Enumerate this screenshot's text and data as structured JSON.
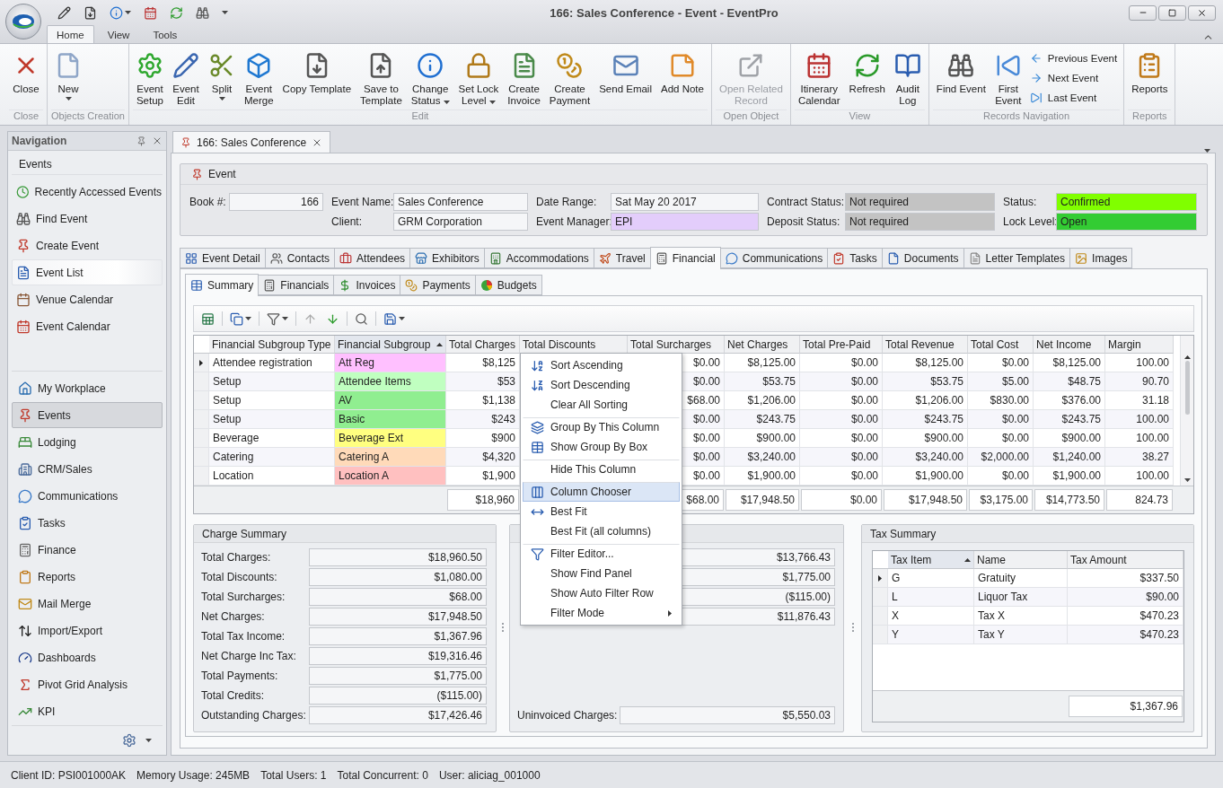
{
  "window": {
    "title": "166: Sales Conference - Event - EventPro"
  },
  "ribbon_tabs": [
    {
      "label": "Home",
      "selected": true
    },
    {
      "label": "View",
      "selected": false
    },
    {
      "label": "Tools",
      "selected": false
    }
  ],
  "ribbon_groups": [
    {
      "label": "Close",
      "buttons": [
        {
          "label": "Close",
          "dropdown": false,
          "disabled": false
        }
      ]
    },
    {
      "label": "Objects Creation",
      "buttons": [
        {
          "label": "New",
          "dropdown": true,
          "disabled": false
        }
      ]
    },
    {
      "label": "Edit",
      "buttons": [
        {
          "label": "Event\nSetup",
          "dropdown": false,
          "disabled": false
        },
        {
          "label": "Event\nEdit",
          "dropdown": false,
          "disabled": false
        },
        {
          "label": "Split",
          "dropdown": true,
          "disabled": false
        },
        {
          "label": "Event\nMerge",
          "dropdown": false,
          "disabled": false
        },
        {
          "label": "Copy Template",
          "dropdown": false,
          "disabled": false
        },
        {
          "label": "Save to\nTemplate",
          "dropdown": false,
          "disabled": false
        },
        {
          "label": "Change\nStatus",
          "dropdown": true,
          "disabled": false
        },
        {
          "label": "Set Lock\nLevel",
          "dropdown": true,
          "disabled": false
        },
        {
          "label": "Create\nInvoice",
          "dropdown": false,
          "disabled": false
        },
        {
          "label": "Create\nPayment",
          "dropdown": false,
          "disabled": false
        },
        {
          "label": "Send Email",
          "dropdown": false,
          "disabled": false
        },
        {
          "label": "Add Note",
          "dropdown": false,
          "disabled": false
        }
      ]
    },
    {
      "label": "Open Object",
      "buttons": [
        {
          "label": "Open Related\nRecord",
          "dropdown": false,
          "disabled": true
        }
      ]
    },
    {
      "label": "View",
      "buttons": [
        {
          "label": "Itinerary\nCalendar",
          "dropdown": false,
          "disabled": false
        },
        {
          "label": "Refresh",
          "dropdown": false,
          "disabled": false
        },
        {
          "label": "Audit\nLog",
          "dropdown": false,
          "disabled": false
        }
      ]
    },
    {
      "label": "Records Navigation",
      "buttons": [
        {
          "label": "Find Event",
          "dropdown": false,
          "disabled": false
        },
        {
          "label": "First\nEvent",
          "dropdown": false,
          "disabled": false
        }
      ],
      "small_buttons": [
        {
          "label": "Previous Event"
        },
        {
          "label": "Next Event"
        },
        {
          "label": "Last Event"
        }
      ]
    },
    {
      "label": "Reports",
      "buttons": [
        {
          "label": "Reports",
          "dropdown": false,
          "disabled": false
        }
      ]
    }
  ],
  "navigation": {
    "title": "Navigation",
    "section": "Events",
    "items": [
      {
        "label": "Recently Accessed Events",
        "selected": false
      },
      {
        "label": "Find Event",
        "selected": false
      },
      {
        "label": "Create Event",
        "selected": false
      },
      {
        "label": "Event List",
        "selected": true
      },
      {
        "label": "Venue Calendar",
        "selected": false
      },
      {
        "label": "Event Calendar",
        "selected": false
      }
    ],
    "modules": [
      {
        "label": "My Workplace",
        "selected": false
      },
      {
        "label": "Events",
        "selected": true
      },
      {
        "label": "Lodging",
        "selected": false
      },
      {
        "label": "CRM/Sales",
        "selected": false
      },
      {
        "label": "Communications",
        "selected": false
      },
      {
        "label": "Tasks",
        "selected": false
      },
      {
        "label": "Finance",
        "selected": false
      },
      {
        "label": "Reports",
        "selected": false
      },
      {
        "label": "Mail Merge",
        "selected": false
      },
      {
        "label": "Import/Export",
        "selected": false
      },
      {
        "label": "Dashboards",
        "selected": false
      },
      {
        "label": "Pivot Grid Analysis",
        "selected": false
      },
      {
        "label": "KPI",
        "selected": false
      }
    ]
  },
  "document_tab": {
    "label": "166: Sales Conference"
  },
  "event_panel": {
    "title": "Event",
    "columns": [
      {
        "fields": [
          {
            "label": "Book #:",
            "value": "166"
          }
        ]
      },
      {
        "fields": [
          {
            "label": "Event Name:",
            "value": "Sales Conference"
          },
          {
            "label": "Client:",
            "value": "GRM Corporation"
          }
        ]
      },
      {
        "fields": [
          {
            "label": "Date Range:",
            "value": "Sat May 20 2017"
          },
          {
            "label": "Event Manager:",
            "value": "EPI",
            "color": "#e3cdfb"
          }
        ]
      },
      {
        "fields": [
          {
            "label": "Contract Status:",
            "value": "Not required",
            "color": "#c3c3c3"
          },
          {
            "label": "Deposit Status:",
            "value": "Not required",
            "color": "#c3c3c3"
          }
        ]
      },
      {
        "fields": [
          {
            "label": "Status:",
            "value": "Confirmed",
            "color": "#80ff00"
          },
          {
            "label": "Lock Level:",
            "value": "Open",
            "color": "#33cc33"
          }
        ]
      }
    ]
  },
  "tabs": [
    {
      "label": "Event Detail",
      "selected": false
    },
    {
      "label": "Contacts",
      "selected": false
    },
    {
      "label": "Attendees",
      "selected": false
    },
    {
      "label": "Exhibitors",
      "selected": false
    },
    {
      "label": "Accommodations",
      "selected": false
    },
    {
      "label": "Travel",
      "selected": false
    },
    {
      "label": "Financial",
      "selected": true
    },
    {
      "label": "Communications",
      "selected": false
    },
    {
      "label": "Tasks",
      "selected": false
    },
    {
      "label": "Documents",
      "selected": false
    },
    {
      "label": "Letter Templates",
      "selected": false
    },
    {
      "label": "Images",
      "selected": false
    }
  ],
  "sub_tabs": [
    {
      "label": "Summary",
      "selected": true
    },
    {
      "label": "Financials",
      "selected": false
    },
    {
      "label": "Invoices",
      "selected": false
    },
    {
      "label": "Payments",
      "selected": false
    },
    {
      "label": "Budgets",
      "selected": false
    }
  ],
  "grid": {
    "columns": [
      {
        "label": "Financial Subgroup Type",
        "sorted": false
      },
      {
        "label": "Financial Subgroup",
        "sorted": true
      },
      {
        "label": "Total Charges",
        "sorted": false
      },
      {
        "label": "Total Discounts",
        "sorted": false
      },
      {
        "label": "Total Surcharges",
        "sorted": false
      },
      {
        "label": "Net Charges",
        "sorted": false
      },
      {
        "label": "Total Pre-Paid",
        "sorted": false
      },
      {
        "label": "Total Revenue",
        "sorted": false
      },
      {
        "label": "Total Cost",
        "sorted": false
      },
      {
        "label": "Net Income",
        "sorted": false
      },
      {
        "label": "Margin",
        "sorted": false
      }
    ],
    "totals": [
      "$18,960",
      "$68.00",
      "$17,948.50",
      "$0.00",
      "$17,948.50",
      "$3,175.00",
      "$14,773.50",
      "824.73"
    ],
    "rows": [
      {
        "current": true,
        "color": "#ffc0ff",
        "cells": [
          "Attendee registration",
          "Att Reg",
          "$8,125",
          null,
          "$0.00",
          "$8,125.00",
          "$0.00",
          "$8,125.00",
          "$0.00",
          "$8,125.00",
          "100.00"
        ]
      },
      {
        "current": false,
        "color": "#c0ffc0",
        "cells": [
          "Setup",
          "Attendee Items",
          "$53",
          null,
          "$0.00",
          "$53.75",
          "$0.00",
          "$53.75",
          "$5.00",
          "$48.75",
          "90.70"
        ]
      },
      {
        "current": false,
        "color": "#90ee90",
        "cells": [
          "Setup",
          "AV",
          "$1,138",
          null,
          "$68.00",
          "$1,206.00",
          "$0.00",
          "$1,206.00",
          "$830.00",
          "$376.00",
          "31.18"
        ]
      },
      {
        "current": false,
        "color": "#90ee90",
        "cells": [
          "Setup",
          "Basic",
          "$243",
          null,
          "$0.00",
          "$243.75",
          "$0.00",
          "$243.75",
          "$0.00",
          "$243.75",
          "100.00"
        ]
      },
      {
        "current": false,
        "color": "#ffff80",
        "cells": [
          "Beverage",
          "Beverage Ext",
          "$900",
          null,
          "$0.00",
          "$900.00",
          "$0.00",
          "$900.00",
          "$0.00",
          "$900.00",
          "100.00"
        ]
      },
      {
        "current": false,
        "color": "#ffdab9",
        "cells": [
          "Catering",
          "Catering A",
          "$4,320",
          null,
          "$0.00",
          "$3,240.00",
          "$0.00",
          "$3,240.00",
          "$2,000.00",
          "$1,240.00",
          "38.27"
        ]
      },
      {
        "current": false,
        "color": "#ffc0c0",
        "cells": [
          "Location",
          "Location A",
          "$1,900",
          null,
          "$0.00",
          "$1,900.00",
          "$0.00",
          "$1,900.00",
          "$0.00",
          "$1,900.00",
          "100.00"
        ]
      }
    ]
  },
  "charge_summary": {
    "title": "Charge Summary",
    "fields": [
      {
        "label": "Total Charges:",
        "value": "$18,960.50"
      },
      {
        "label": "Total Discounts:",
        "value": "$1,080.00"
      },
      {
        "label": "Total Surcharges:",
        "value": "$68.00"
      },
      {
        "label": "Net Charges:",
        "value": "$17,948.50"
      },
      {
        "label": "Total Tax Income:",
        "value": "$1,367.96"
      },
      {
        "label": "Net Charge Inc Tax:",
        "value": "$19,316.46"
      },
      {
        "label": "Total Payments:",
        "value": "$1,775.00"
      },
      {
        "label": "Total Credits:",
        "value": "($115.00)"
      },
      {
        "label": "Outstanding Charges:",
        "value": "$17,426.46"
      }
    ]
  },
  "invoice_summary": {
    "fields": [
      {
        "value": "$13,766.43"
      },
      {
        "value": "$1,775.00"
      },
      {
        "value": "($115.00)"
      },
      {
        "value": "$11,876.43"
      }
    ],
    "footer_field": {
      "label": "Uninvoiced Charges:",
      "value": "$5,550.03"
    }
  },
  "tax_summary": {
    "title": "Tax Summary",
    "columns": [
      {
        "label": "Tax Item",
        "sorted": true
      },
      {
        "label": "Name",
        "sorted": false
      },
      {
        "label": "Tax Amount",
        "sorted": false
      }
    ],
    "rows": [
      {
        "current": true,
        "cells": [
          "G",
          "Gratuity",
          "$337.50"
        ]
      },
      {
        "current": false,
        "cells": [
          "L",
          "Liquor Tax",
          "$90.00"
        ]
      },
      {
        "current": false,
        "cells": [
          "X",
          "Tax X",
          "$470.23"
        ]
      },
      {
        "current": false,
        "cells": [
          "Y",
          "Tax Y",
          "$470.23"
        ]
      }
    ],
    "total": "$1,367.96"
  },
  "context_menu": {
    "items": [
      {
        "label": "Sort Ascending",
        "separator_before": false,
        "highlighted": false,
        "submenu": false
      },
      {
        "label": "Sort Descending",
        "separator_before": false,
        "highlighted": false,
        "submenu": false
      },
      {
        "label": "Clear All Sorting",
        "separator_before": false,
        "highlighted": false,
        "submenu": false
      },
      {
        "label": "Group By This Column",
        "separator_before": true,
        "highlighted": false,
        "submenu": false
      },
      {
        "label": "Show Group By Box",
        "separator_before": false,
        "highlighted": false,
        "submenu": false
      },
      {
        "label": "Hide This Column",
        "separator_before": true,
        "highlighted": false,
        "submenu": false
      },
      {
        "label": "Column Chooser",
        "separator_before": true,
        "highlighted": true,
        "submenu": false
      },
      {
        "label": "Best Fit",
        "separator_before": false,
        "highlighted": false,
        "submenu": false
      },
      {
        "label": "Best Fit (all columns)",
        "separator_before": false,
        "highlighted": false,
        "submenu": false
      },
      {
        "label": "Filter Editor...",
        "separator_before": true,
        "highlighted": false,
        "submenu": false
      },
      {
        "label": "Show Find Panel",
        "separator_before": false,
        "highlighted": false,
        "submenu": false
      },
      {
        "label": "Show Auto Filter Row",
        "separator_before": false,
        "highlighted": false,
        "submenu": false
      },
      {
        "label": "Filter Mode",
        "separator_before": false,
        "highlighted": false,
        "submenu": true
      }
    ]
  },
  "status_bar": {
    "items": [
      "Client ID: PSI001000AK",
      "Memory Usage: 245MB",
      "Total Users: 1",
      "Total Concurrent: 0",
      "User: aliciag_001000"
    ]
  }
}
